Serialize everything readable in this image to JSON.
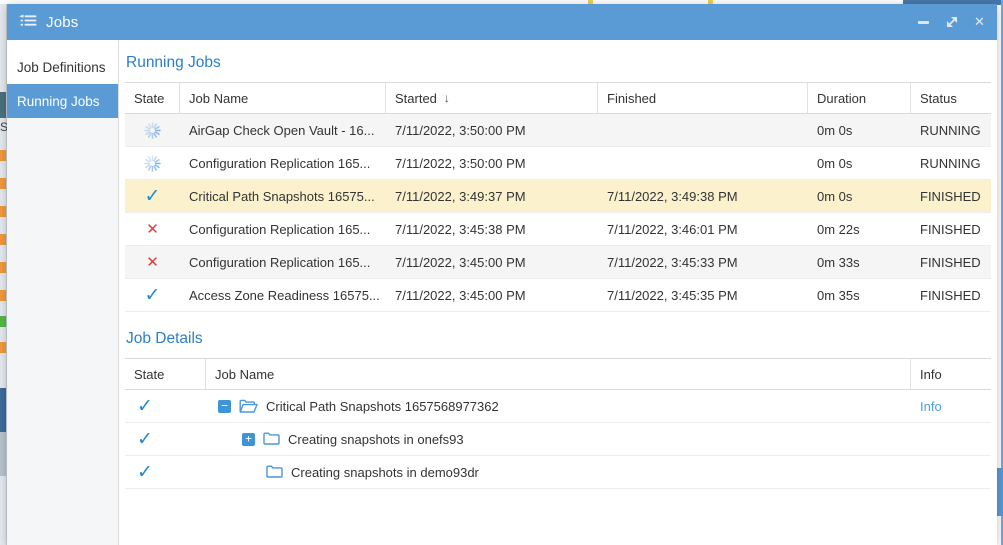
{
  "window": {
    "title": "Jobs",
    "controls": {
      "minimize": "minimize",
      "maximize": "maximize",
      "close": "close"
    }
  },
  "sidebar": {
    "items": [
      {
        "label": "Job Definitions",
        "selected": false
      },
      {
        "label": "Running Jobs",
        "selected": true
      }
    ]
  },
  "running_jobs": {
    "title": "Running Jobs",
    "columns": {
      "state": "State",
      "job_name": "Job Name",
      "started": "Started",
      "finished": "Finished",
      "duration": "Duration",
      "status": "Status"
    },
    "sort": {
      "column": "Started",
      "direction": "desc",
      "arrow": "↓"
    },
    "rows": [
      {
        "state": "running",
        "job_name": "AirGap Check Open Vault - 16...",
        "started": "7/11/2022, 3:50:00 PM",
        "finished": "",
        "duration": "0m 0s",
        "status": "RUNNING",
        "highlight": false
      },
      {
        "state": "running",
        "job_name": "Configuration Replication 165...",
        "started": "7/11/2022, 3:50:00 PM",
        "finished": "",
        "duration": "0m 0s",
        "status": "RUNNING",
        "highlight": false
      },
      {
        "state": "success",
        "job_name": "Critical Path Snapshots 16575...",
        "started": "7/11/2022, 3:49:37 PM",
        "finished": "7/11/2022, 3:49:38 PM",
        "duration": "0m 0s",
        "status": "FINISHED",
        "highlight": true
      },
      {
        "state": "error",
        "job_name": "Configuration Replication 165...",
        "started": "7/11/2022, 3:45:38 PM",
        "finished": "7/11/2022, 3:46:01 PM",
        "duration": "0m 22s",
        "status": "FINISHED",
        "highlight": false
      },
      {
        "state": "error",
        "job_name": "Configuration Replication 165...",
        "started": "7/11/2022, 3:45:00 PM",
        "finished": "7/11/2022, 3:45:33 PM",
        "duration": "0m 33s",
        "status": "FINISHED",
        "highlight": false
      },
      {
        "state": "success",
        "job_name": "Access Zone Readiness 16575...",
        "started": "7/11/2022, 3:45:00 PM",
        "finished": "7/11/2022, 3:45:35 PM",
        "duration": "0m 35s",
        "status": "FINISHED",
        "highlight": false
      }
    ]
  },
  "job_details": {
    "title": "Job Details",
    "columns": {
      "state": "State",
      "job_name": "Job Name",
      "info": "Info"
    },
    "rows": [
      {
        "state": "success",
        "expander": "collapse",
        "folder": "open",
        "level": 0,
        "label": "Critical Path Snapshots 1657568977362",
        "info": "Info"
      },
      {
        "state": "success",
        "expander": "expand",
        "folder": "closed",
        "level": 1,
        "label": "Creating snapshots in onefs93",
        "info": ""
      },
      {
        "state": "success",
        "expander": "none",
        "folder": "closed",
        "level": 2,
        "label": "Creating snapshots in demo93dr",
        "info": ""
      }
    ]
  },
  "colors": {
    "titlebar_blue": "#5b9bd5",
    "heading_blue": "#2d7fc3",
    "link_blue": "#4aa0e8",
    "check_blue": "#2089d5",
    "error_red": "#e23b3b",
    "spinner_blue": "#7fb5e8",
    "highlight_row": "#fbf2cd",
    "alt_row": "#f5f5f5"
  }
}
